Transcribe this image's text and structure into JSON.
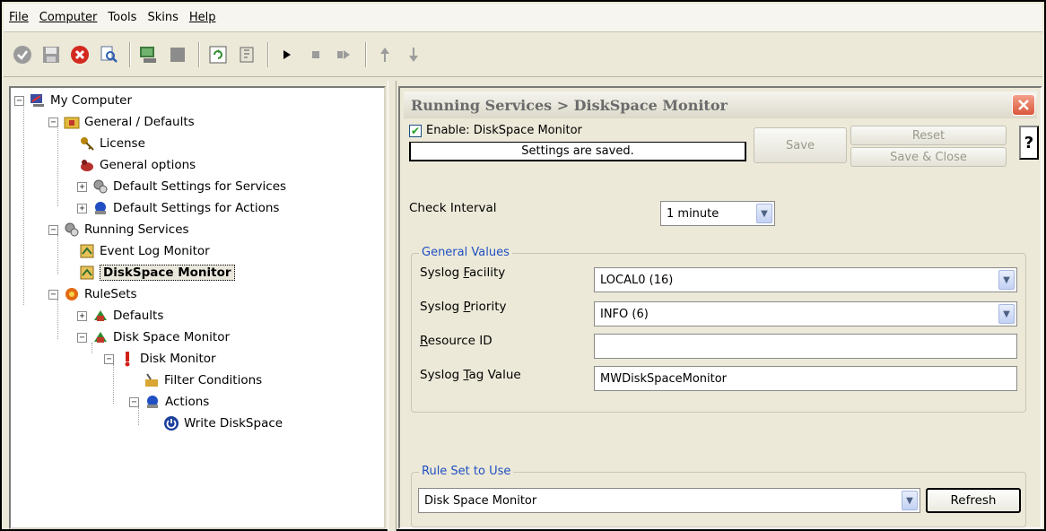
{
  "menu": {
    "items": [
      {
        "label": "File"
      },
      {
        "label": "Computer"
      },
      {
        "label": "Tools"
      },
      {
        "label": "Skins"
      },
      {
        "label": "Help"
      }
    ]
  },
  "tree": {
    "root": "My Computer",
    "general_defaults": "General / Defaults",
    "license": "License",
    "general_options": "General options",
    "default_services": "Default Settings for Services",
    "default_actions": "Default Settings for Actions",
    "running_services": "Running Services",
    "event_log_monitor": "Event Log Monitor",
    "diskspace_monitor": "DiskSpace Monitor",
    "rulesets": "RuleSets",
    "defaults": "Defaults",
    "disk_space_monitor": "Disk Space Monitor",
    "disk_monitor": "Disk Monitor",
    "filter_conditions": "Filter Conditions",
    "actions": "Actions",
    "write_diskspace": "Write DiskSpace"
  },
  "panel": {
    "title": "Running Services > DiskSpace Monitor",
    "enable_label": "Enable: DiskSpace Monitor",
    "status": "Settings are saved.",
    "save": "Save",
    "reset": "Reset",
    "save_close": "Save & Close",
    "help": "?",
    "check_interval_label": "Check Interval",
    "check_interval_value": "1 minute",
    "general_values_legend": "General Values",
    "syslog_facility_value": "LOCAL0 (16)",
    "syslog_priority_value": "INFO (6)",
    "resource_id_value": "",
    "syslog_tag_value": "MWDiskSpaceMonitor",
    "rule_set_legend": "Rule Set to Use",
    "rule_set_value": "Disk Space Monitor",
    "refresh": "Refresh"
  },
  "colors": {
    "accent_blue": "#1f4fc2",
    "window_bg": "#ece9d8",
    "close_red": "#d9573a"
  }
}
